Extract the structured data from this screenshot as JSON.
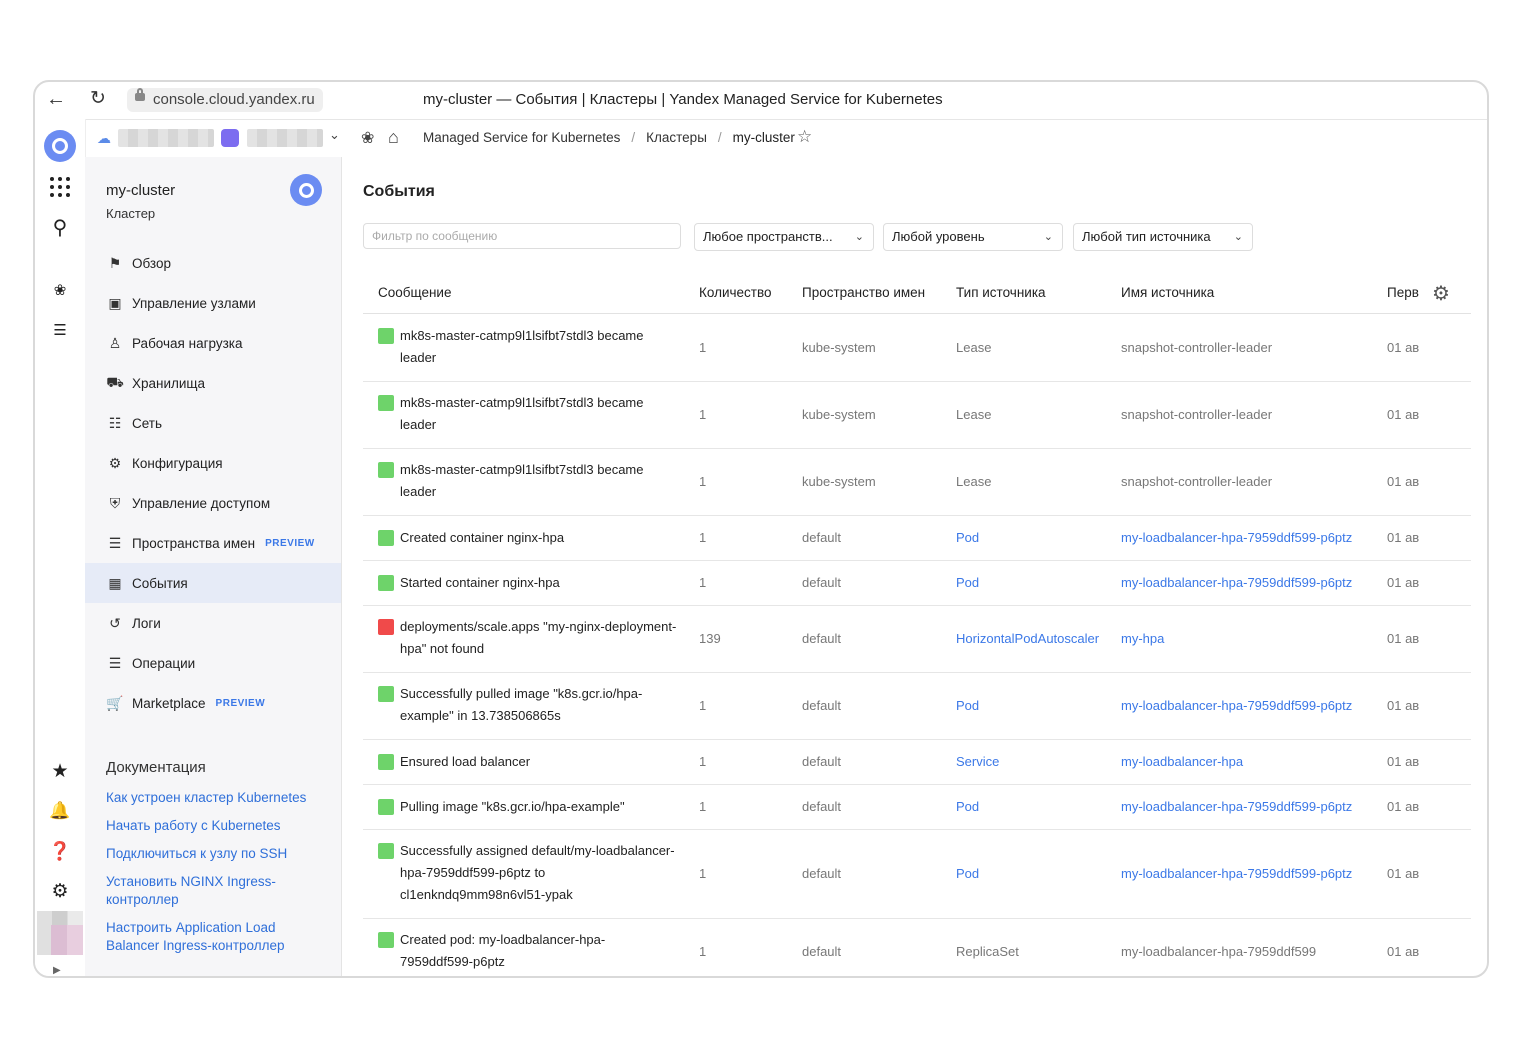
{
  "browser": {
    "url": "console.cloud.yandex.ru",
    "title": "my-cluster — События | Кластеры | Yandex Managed Service for Kubernetes"
  },
  "topbar": {
    "breadcrumbs": [
      "Managed Service for Kubernetes",
      "Кластеры",
      "my-cluster"
    ]
  },
  "sidebar": {
    "title": "my-cluster",
    "subtitle": "Кластер",
    "items": [
      {
        "label": "Обзор",
        "icon": "flag-icon"
      },
      {
        "label": "Управление узлами",
        "icon": "nodes-icon"
      },
      {
        "label": "Рабочая нагрузка",
        "icon": "workload-icon"
      },
      {
        "label": "Хранилища",
        "icon": "database-icon"
      },
      {
        "label": "Сеть",
        "icon": "network-icon"
      },
      {
        "label": "Конфигурация",
        "icon": "config-icon"
      },
      {
        "label": "Управление доступом",
        "icon": "shield-icon"
      },
      {
        "label": "Пространства имен",
        "icon": "layers-icon",
        "badge": "PREVIEW"
      },
      {
        "label": "События",
        "icon": "calendar-icon"
      },
      {
        "label": "Логи",
        "icon": "history-icon"
      },
      {
        "label": "Операции",
        "icon": "list-icon"
      },
      {
        "label": "Marketplace",
        "icon": "cart-icon",
        "badge": "PREVIEW"
      }
    ],
    "docs_title": "Документация",
    "docs": [
      "Как устроен кластер Kubernetes",
      "Начать работу с Kubernetes",
      "Подключиться к узлу по SSH",
      "Установить NGINX Ingress-контроллер",
      "Настроить Application Load Balancer Ingress-контроллер"
    ]
  },
  "main": {
    "title": "События",
    "filter_placeholder": "Фильтр по сообщению",
    "selects": [
      "Любое пространств...",
      "Любой уровень",
      "Любой тип источника"
    ],
    "columns": [
      "Сообщение",
      "Количество",
      "Пространство имен",
      "Тип источника",
      "Имя источника",
      "Перв"
    ],
    "rows": [
      {
        "message": "mk8s-master-catmp9l1lsifbt7stdl3 became leader",
        "level": "#6ed36a",
        "count": "1",
        "namespace": "kube-system",
        "type": "Lease",
        "name": "snapshot-controller-leader",
        "first": "01 ав"
      },
      {
        "message": "mk8s-master-catmp9l1lsifbt7stdl3 became leader",
        "level": "#6ed36a",
        "count": "1",
        "namespace": "kube-system",
        "type": "Lease",
        "name": "snapshot-controller-leader",
        "first": "01 ав"
      },
      {
        "message": "mk8s-master-catmp9l1lsifbt7stdl3 became leader",
        "level": "#6ed36a",
        "count": "1",
        "namespace": "kube-system",
        "type": "Lease",
        "name": "snapshot-controller-leader",
        "first": "01 ав"
      },
      {
        "message": "Created container nginx-hpa",
        "level": "#6ed36a",
        "count": "1",
        "namespace": "default",
        "type": "Pod",
        "name": "my-loadbalancer-hpa-7959ddf599-p6ptz",
        "first": "01 ав"
      },
      {
        "message": "Started container nginx-hpa",
        "level": "#6ed36a",
        "count": "1",
        "namespace": "default",
        "type": "Pod",
        "name": "my-loadbalancer-hpa-7959ddf599-p6ptz",
        "first": "01 ав"
      },
      {
        "message": "deployments/scale.apps \"my-nginx-deployment-hpa\" not found",
        "level": "#f04a4a",
        "count": "139",
        "namespace": "default",
        "type": "HorizontalPodAutoscaler",
        "name": "my-hpa",
        "first": "01 ав"
      },
      {
        "message": "Successfully pulled image \"k8s.gcr.io/hpa-example\" in 13.738506865s",
        "level": "#6ed36a",
        "count": "1",
        "namespace": "default",
        "type": "Pod",
        "name": "my-loadbalancer-hpa-7959ddf599-p6ptz",
        "first": "01 ав"
      },
      {
        "message": "Ensured load balancer",
        "level": "#6ed36a",
        "count": "1",
        "namespace": "default",
        "type": "Service",
        "name": "my-loadbalancer-hpa",
        "first": "01 ав"
      },
      {
        "message": "Pulling image \"k8s.gcr.io/hpa-example\"",
        "level": "#6ed36a",
        "count": "1",
        "namespace": "default",
        "type": "Pod",
        "name": "my-loadbalancer-hpa-7959ddf599-p6ptz",
        "first": "01 ав"
      },
      {
        "message": "Successfully assigned default/my-loadbalancer-hpa-7959ddf599-p6ptz to cl1enkndq9mm98n6vl51-ypak",
        "level": "#6ed36a",
        "count": "1",
        "namespace": "default",
        "type": "Pod",
        "name": "my-loadbalancer-hpa-7959ddf599-p6ptz",
        "first": "01 ав"
      },
      {
        "message": "Created pod: my-loadbalancer-hpa-7959ddf599-p6ptz",
        "level": "#6ed36a",
        "count": "1",
        "namespace": "default",
        "type": "ReplicaSet",
        "name": "my-loadbalancer-hpa-7959ddf599",
        "first": "01 ав"
      }
    ]
  },
  "colors": {
    "accent": "#6b8cf2",
    "link": "#3b78e7",
    "ok": "#6ed36a",
    "error": "#f04a4a"
  }
}
